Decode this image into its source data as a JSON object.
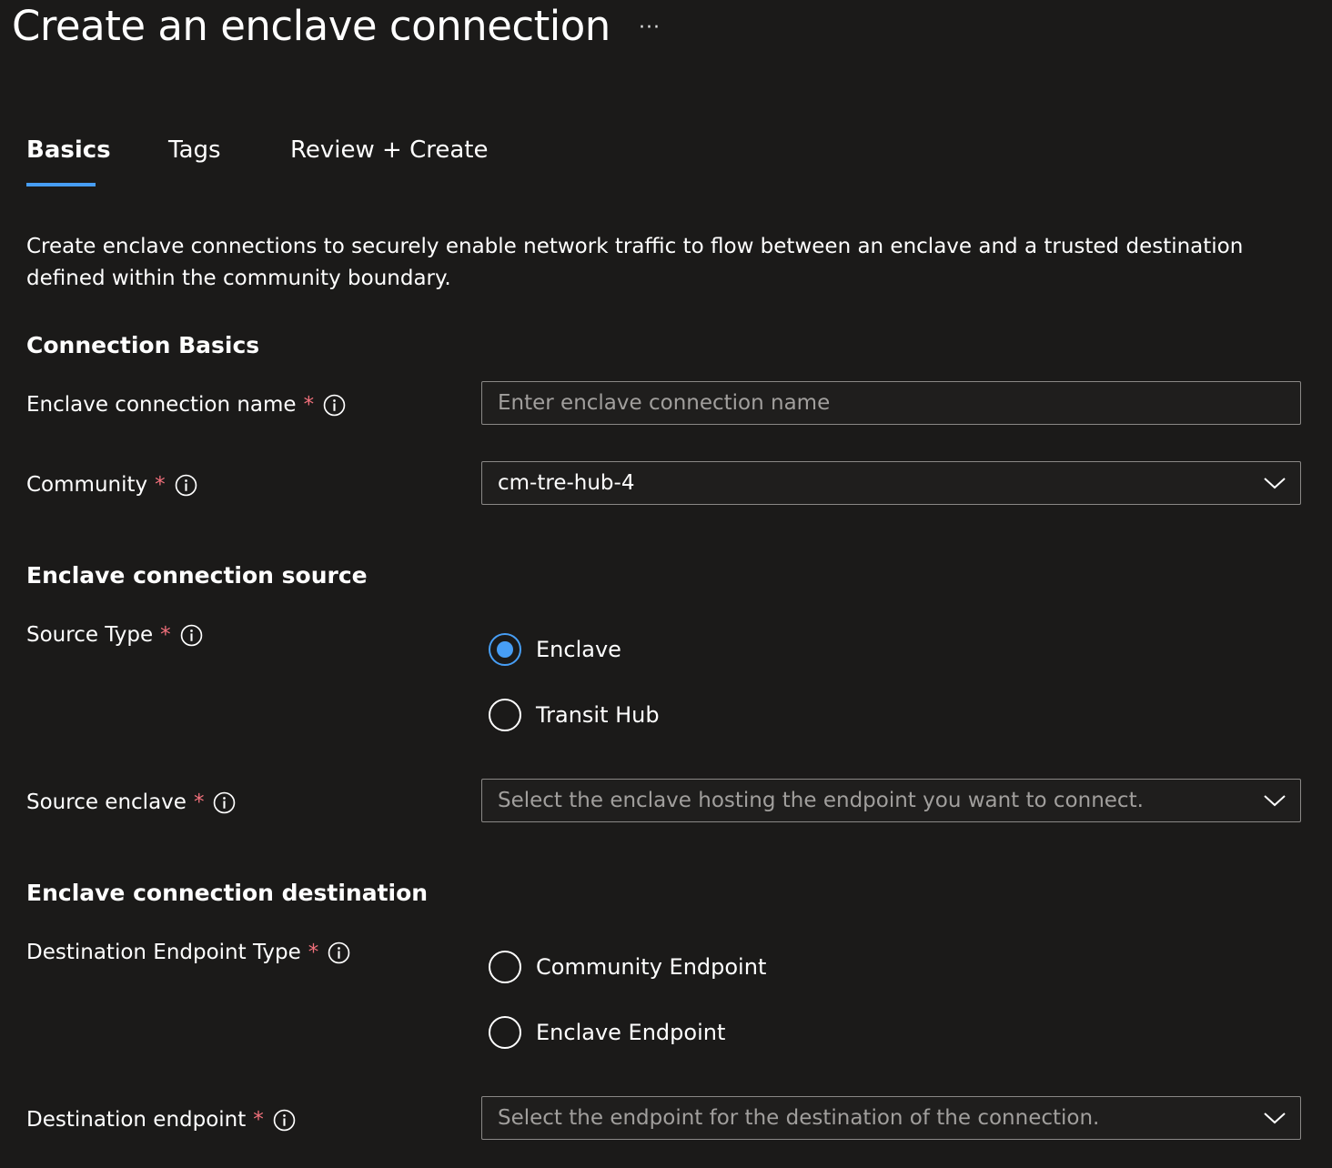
{
  "header": {
    "title": "Create an enclave connection",
    "more_label": "···"
  },
  "tabs": [
    {
      "label": "Basics",
      "active": true
    },
    {
      "label": "Tags",
      "active": false
    },
    {
      "label": "Review + Create",
      "active": false
    }
  ],
  "intro": "Create enclave connections to securely enable network traffic to flow between an enclave and a trusted destination defined within the community boundary.",
  "sections": {
    "basics": {
      "title": "Connection Basics",
      "name_field": {
        "label": "Enclave connection name",
        "required_mark": "*",
        "placeholder": "Enter enclave connection name",
        "value": ""
      },
      "community_field": {
        "label": "Community",
        "required_mark": "*",
        "value": "cm-tre-hub-4"
      }
    },
    "source": {
      "title": "Enclave connection source",
      "source_type": {
        "label": "Source Type",
        "required_mark": "*",
        "options": [
          {
            "label": "Enclave",
            "checked": true
          },
          {
            "label": "Transit Hub",
            "checked": false
          }
        ]
      },
      "source_enclave": {
        "label": "Source enclave",
        "required_mark": "*",
        "placeholder": "Select the enclave hosting the endpoint you want to connect."
      }
    },
    "destination": {
      "title": "Enclave connection destination",
      "endpoint_type": {
        "label": "Destination Endpoint Type",
        "required_mark": "*",
        "options": [
          {
            "label": "Community Endpoint",
            "checked": false
          },
          {
            "label": "Enclave Endpoint",
            "checked": false
          }
        ]
      },
      "endpoint": {
        "label": "Destination endpoint",
        "required_mark": "*",
        "placeholder": "Select the endpoint for the destination of the connection."
      }
    }
  },
  "icons": {
    "info": "info-icon",
    "chevron": "chevron-down-icon",
    "more": "more-icon"
  },
  "colors": {
    "background": "#1b1a19",
    "accent": "#479ef5",
    "required": "#f1707b",
    "border": "#8a8886"
  }
}
